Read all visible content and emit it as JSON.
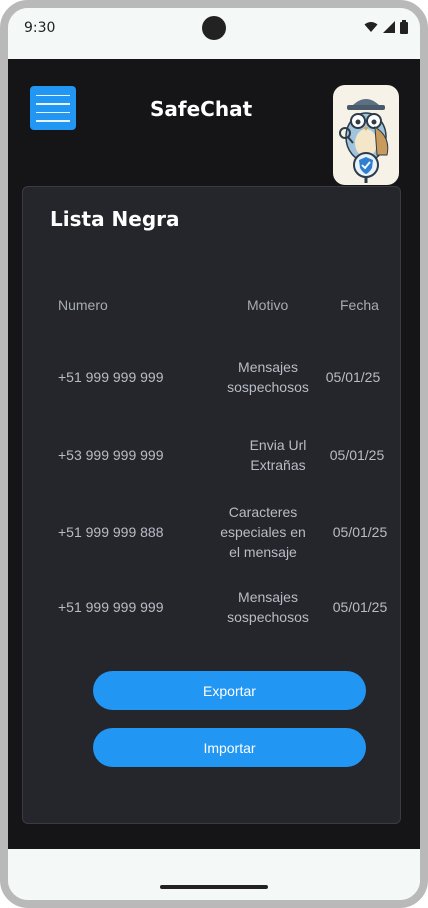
{
  "status_bar": {
    "time": "9:30"
  },
  "app": {
    "title": "SafeChat"
  },
  "card": {
    "title": "Lista Negra",
    "headers": {
      "number": "Numero",
      "reason": "Motivo",
      "date": "Fecha"
    },
    "rows": [
      {
        "number": "+51 999 999 999",
        "reason_lines": [
          "Mensajes",
          "sospechosos"
        ],
        "date": "05/01/25"
      },
      {
        "number": "+53 999 999 999",
        "reason_lines": [
          "Envia Url",
          "Extrañas"
        ],
        "date": "05/01/25"
      },
      {
        "number": "+51 999 999 888",
        "reason_lines": [
          "Caracteres",
          "especiales en",
          "el mensaje"
        ],
        "date": "05/01/25"
      },
      {
        "number": "+51 999 999 999",
        "reason_lines": [
          "Mensajes",
          "sospechosos"
        ],
        "date": "05/01/25"
      }
    ],
    "buttons": {
      "export": "Exportar",
      "import": "Importar"
    }
  },
  "colors": {
    "accent": "#2196f3",
    "background": "#151517",
    "card": "#24262c"
  }
}
